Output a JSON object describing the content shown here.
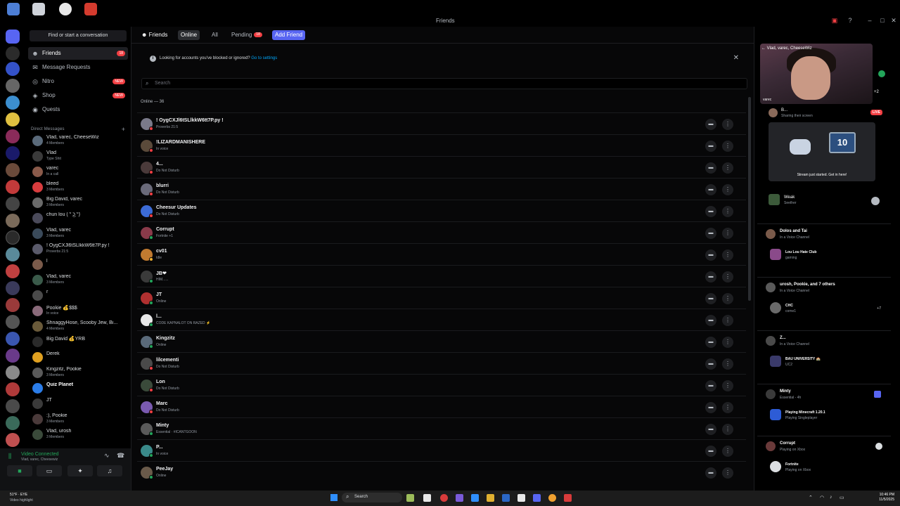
{
  "window": {
    "title": "Friends"
  },
  "colors": {
    "accent": "#5865f2",
    "danger": "#f23f43",
    "online": "#23a55a",
    "idle": "#f0b232",
    "dnd": "#f23f43"
  },
  "sidebar": {
    "find_placeholder": "Find or start a conversation",
    "nav": [
      {
        "label": "Friends",
        "badge": "18",
        "icon": "friends-icon"
      },
      {
        "label": "Message Requests",
        "icon": "mail-icon"
      },
      {
        "label": "Nitro",
        "badge": "NEW",
        "icon": "nitro-icon"
      },
      {
        "label": "Shop",
        "badge": "NEW",
        "icon": "shop-icon"
      },
      {
        "label": "Quests",
        "icon": "quests-icon"
      }
    ],
    "dm_header": "Direct Messages",
    "dms": [
      {
        "name": "Vlad, varec, CheeseWiz",
        "sub": "4 Members"
      },
      {
        "name": "Vlad",
        "sub": "Type Shit"
      },
      {
        "name": "varec",
        "sub": "In a call"
      },
      {
        "name": "bleed",
        "sub": "3 Members"
      },
      {
        "name": "Big David, varec",
        "sub": "3 Members"
      },
      {
        "name": "chun lou ( ͡° ͜ʖ ͡°)",
        "sub": ""
      },
      {
        "name": "Vlad, varec",
        "sub": "3 Members"
      },
      {
        "name": "! OygCXJl6tSLlkkW6tt7P.py !",
        "sub": "Proverbs 21:5"
      },
      {
        "name": "l",
        "sub": ""
      },
      {
        "name": "Vlad, varec",
        "sub": "3 Members"
      },
      {
        "name": "r",
        "sub": ""
      },
      {
        "name": "Pookie 💰$$$",
        "sub": "In voice"
      },
      {
        "name": "ShnaggyHose, Scooby Jew, Bi...",
        "sub": "4 Members"
      },
      {
        "name": "Big David 💰YRB",
        "sub": ""
      },
      {
        "name": "Derek",
        "sub": ""
      },
      {
        "name": "Kingzitz, Pookie",
        "sub": "3 Members"
      },
      {
        "name": "Quiz Planet",
        "sub": ""
      },
      {
        "name": "JT",
        "sub": ""
      },
      {
        "name": ":), Pookie",
        "sub": "3 Members"
      },
      {
        "name": "Vlad, urosh",
        "sub": "3 Members"
      }
    ],
    "voice": {
      "title": "Video Connected",
      "sub": "Vlad, varec, Cheesewiz"
    }
  },
  "main": {
    "tabs": {
      "friends": "Friends",
      "online": "Online",
      "all": "All",
      "pending": "Pending",
      "pending_badge": "18",
      "add": "Add Friend"
    },
    "notice": {
      "text": "Looking for accounts you've blocked or ignored?",
      "link": "Go to settings"
    },
    "search_placeholder": "Search",
    "online_count": "Online — 36",
    "friends": [
      {
        "name": "! OygCXJl6tSLlkkW6tt7P.py !",
        "sub": "Proverbs 21:5",
        "status": "dnd"
      },
      {
        "name": "!LIZARDMANISHERE",
        "sub": "In voice",
        "status": "dnd"
      },
      {
        "name": "4...",
        "sub": "Do Not Disturb",
        "status": "dnd"
      },
      {
        "name": "blurri",
        "sub": "Do Not Disturb",
        "status": "dnd"
      },
      {
        "name": "Cheesur Updates",
        "sub": "Do Not Disturb",
        "status": "dnd"
      },
      {
        "name": "Corrupt",
        "sub": "Fortnite +1",
        "status": "online"
      },
      {
        "name": "cv01",
        "sub": "Idle",
        "status": "idle"
      },
      {
        "name": "JB❤",
        "sub": "HIM......",
        "status": "online"
      },
      {
        "name": "JT",
        "sub": "Online",
        "status": "online"
      },
      {
        "name": "l...",
        "sub": "CODE KAPNALOT ON RAZED ⚡",
        "status": "online"
      },
      {
        "name": "Kingzitz",
        "sub": "Online",
        "status": "online"
      },
      {
        "name": "lilcementi",
        "sub": "Do Not Disturb",
        "status": "dnd"
      },
      {
        "name": "Lon",
        "sub": "Do Not Disturb",
        "status": "dnd"
      },
      {
        "name": "Marc",
        "sub": "Do Not Disturb",
        "status": "dnd"
      },
      {
        "name": "Minty",
        "sub": "Essential · #ICANTGOON",
        "status": "online"
      },
      {
        "name": "P...",
        "sub": "In voice",
        "status": "online"
      },
      {
        "name": "PeeJay",
        "sub": "Online",
        "status": "online"
      }
    ]
  },
  "activity": {
    "video_label": "Vlad, varec, CheeseWiz",
    "video_user": "varec",
    "plus": "+2",
    "live": {
      "name": "B...",
      "sub": "Sharing their screen",
      "badge": "LIVE",
      "caption": "Stream just started. Get in here!",
      "tv_text": "10",
      "game": "Weak",
      "game_sub": "Seether"
    },
    "cards": [
      {
        "head": "Dolos and Tai",
        "head_sub": "In a Voice Channel",
        "channel": "Lou Lou Hate Club",
        "channel_sub": "gaming"
      },
      {
        "head": "urosh, Pookie, and 7 others",
        "head_sub": "In a Voice Channel",
        "channel": "CHC",
        "channel_sub": "come1",
        "extra": "+7"
      },
      {
        "head": "Z...",
        "head_sub": "In a Voice Channel",
        "channel": "BAU UNIVERSITY 🏫",
        "channel_sub": "UC2"
      },
      {
        "head": "Minty",
        "head_sub": "Essential - 4h",
        "channel": "Playing Minecraft 1.20.1",
        "channel_sub": "Playing Singleplayer"
      },
      {
        "head": "Corrupt",
        "head_sub": "Playing on Xbox",
        "channel": "Fortnite",
        "channel_sub": "Playing on Xbox"
      }
    ]
  },
  "taskbar": {
    "weather": "51°F · EYE",
    "weather_sub": "Video highlight",
    "search": "Search",
    "time": "10:46 PM",
    "date": "11/5/2025"
  }
}
